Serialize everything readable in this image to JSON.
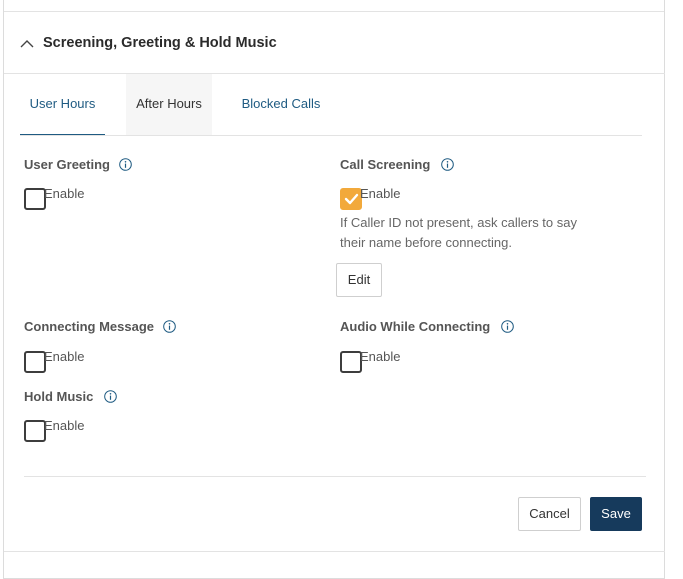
{
  "section": {
    "title": "Screening, Greeting & Hold Music",
    "expanded": true
  },
  "tabs": [
    {
      "label": "User Hours",
      "active": true
    },
    {
      "label": "After Hours",
      "active": false
    },
    {
      "label": "Blocked Calls",
      "active": false
    }
  ],
  "settings": {
    "user_greeting": {
      "label": "User Greeting",
      "checkbox_label": "Enable",
      "checked": false
    },
    "call_screening": {
      "label": "Call Screening",
      "checkbox_label": "Enable",
      "checked": true,
      "description": "If Caller ID not present, ask callers to say their name before connecting.",
      "edit_label": "Edit"
    },
    "connecting_message": {
      "label": "Connecting Message",
      "checkbox_label": "Enable",
      "checked": false
    },
    "audio_while_connecting": {
      "label": "Audio While Connecting",
      "checkbox_label": "Enable",
      "checked": false
    },
    "hold_music": {
      "label": "Hold Music",
      "checkbox_label": "Enable",
      "checked": false
    }
  },
  "footer": {
    "cancel_label": "Cancel",
    "save_label": "Save"
  },
  "colors": {
    "accent": "#1f5b82",
    "save_button": "#163a5c",
    "checkbox_checked": "#f2a93b"
  }
}
